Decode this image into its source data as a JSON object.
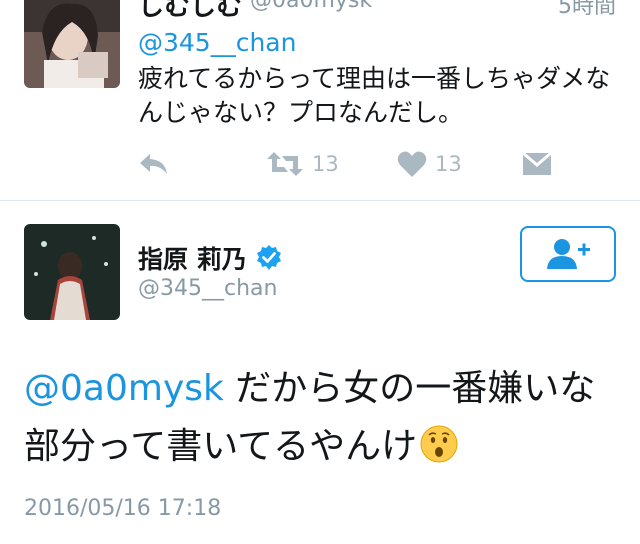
{
  "reply_tweet": {
    "display_name": "しむしむ",
    "handle": "@0a0mysk",
    "time": "5時間",
    "mention": "@345__chan",
    "text": "疲れてるからって理由は一番しちゃダメなんじゃない？プロなんだし。",
    "retweet_count": "13",
    "like_count": "13"
  },
  "main_tweet": {
    "display_name": "指原 莉乃",
    "handle": "@345__chan",
    "mention": "@0a0mysk",
    "text": " だから女の一番嫌いな部分って書いてるやんけ",
    "timestamp": "2016/05/16 17:18"
  },
  "colors": {
    "link": "#1b95e0",
    "muted": "#8899a6",
    "icon": "#aab8c2",
    "verified": "#1da1f2"
  },
  "icons": {
    "reply": "reply-icon",
    "retweet": "retweet-icon",
    "like": "heart-icon",
    "dm": "direct-message-icon",
    "follow": "follow-user-icon",
    "verified": "verified-badge-icon",
    "emoji": "hushed-face-emoji"
  }
}
